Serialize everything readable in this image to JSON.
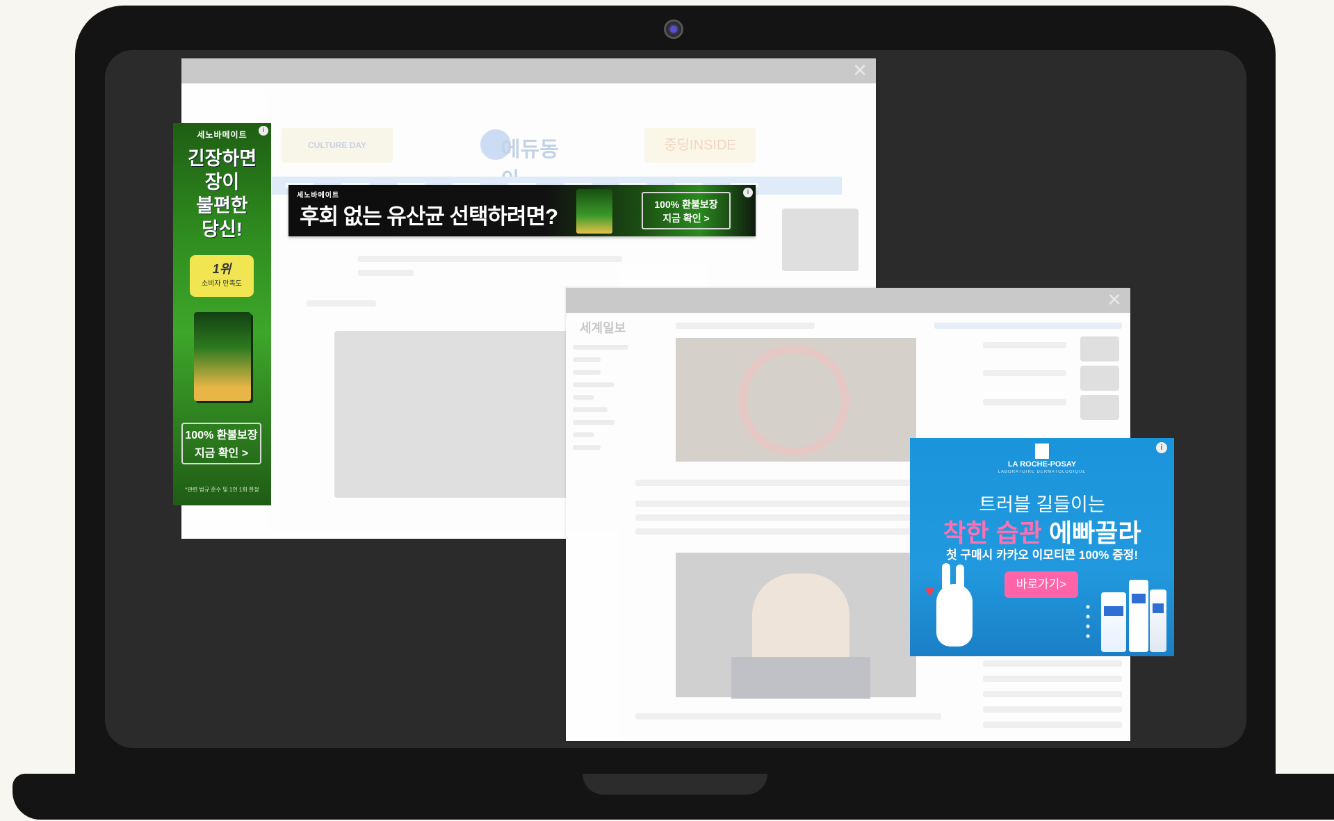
{
  "windows": {
    "back": {
      "close_glyph": "✕",
      "logo": "에듀동아",
      "left_banner": "CULTURE DAY",
      "right_banner": "중딩INSIDE"
    },
    "front": {
      "close_glyph": "✕",
      "logo": "세계일보"
    }
  },
  "ads": {
    "skyscraper": {
      "brand": "세노바메이트",
      "info": "i",
      "headline": [
        "긴장하면",
        "장이",
        "불편한",
        "당신!"
      ],
      "badge_rank": "1위",
      "badge_sub": "소비자 만족도",
      "cta_line1": "100% 환불보장",
      "cta_line2": "지금 확인 >",
      "fine_print": "*관련 법규 준수 및 1인 1회 한정"
    },
    "leaderboard": {
      "brand": "세노바메이트",
      "info": "i",
      "headline": "후회 없는 유산균 선택하려면?",
      "cta_line1": "100% 환불보장",
      "cta_line2": "지금 확인 >"
    },
    "laroche": {
      "info": "i",
      "brand": "LA ROCHE-POSAY",
      "brand_sub": "LABORATOIRE DERMATOLOGIQUE",
      "line1": "트러블 길들이는",
      "line2_pink": "착한 습관",
      "line2_white": "에빠끌라",
      "line3": "첫 구매시 카카오 이모티콘 100% 증정!",
      "cta": "바로가기>"
    }
  },
  "colors": {
    "ad_green": "#2f8d1f",
    "ad_blue": "#1a94db",
    "ad_pink": "#ff63a8",
    "laptop": "#141414"
  }
}
